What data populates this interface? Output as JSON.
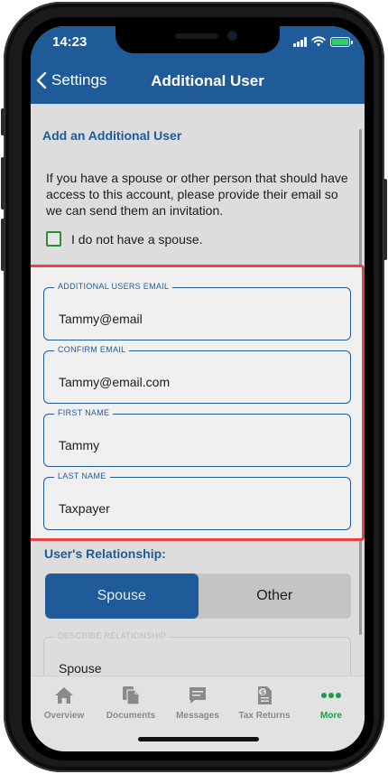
{
  "status_bar": {
    "time": "14:23"
  },
  "nav": {
    "back_label": "Settings",
    "title": "Additional User"
  },
  "section": {
    "title": "Add an Additional User",
    "intro": "If you have a spouse or other person that should have access to this account, please provide their email so we can send them an invitation.",
    "checkbox_label": "I do not have a spouse."
  },
  "fields": {
    "email": {
      "label": "ADDITIONAL USERS EMAIL",
      "value": "Tammy@email"
    },
    "confirm": {
      "label": "CONFIRM EMAIL",
      "value": "Tammy@email.com"
    },
    "first_name": {
      "label": "FIRST NAME",
      "value": "Tammy"
    },
    "last_name": {
      "label": "LAST NAME",
      "value": "Taxpayer"
    }
  },
  "relationship": {
    "title": "User's Relationship:",
    "options": [
      "Spouse",
      "Other"
    ],
    "selected": "Spouse",
    "describe_label": "DESCRIBE RELATIONSHIP",
    "describe_value": "Spouse"
  },
  "tabbar": {
    "items": [
      {
        "label": "Overview",
        "icon": "home-icon"
      },
      {
        "label": "Documents",
        "icon": "documents-icon"
      },
      {
        "label": "Messages",
        "icon": "message-icon"
      },
      {
        "label": "Tax Returns",
        "icon": "tax-return-icon"
      },
      {
        "label": "More",
        "icon": "more-dots-icon"
      }
    ],
    "active": "More"
  },
  "colors": {
    "primary": "#1f5b99",
    "highlight": "#e8414a",
    "active_tab": "#1f9a4b",
    "checkbox": "#2e8b3a"
  }
}
